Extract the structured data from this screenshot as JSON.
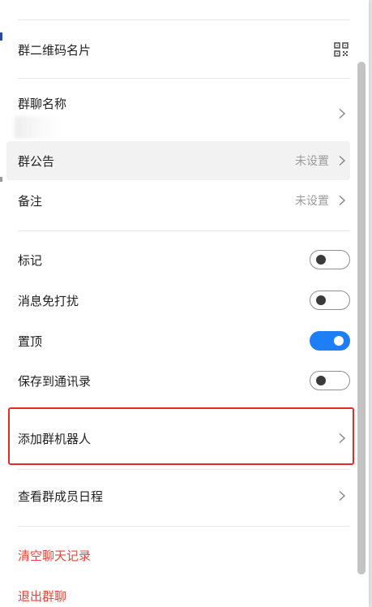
{
  "menu": {
    "qr_card": {
      "label": "群二维码名片",
      "icon": "qr-code-icon"
    },
    "group_name": {
      "label": "群聊名称"
    },
    "announcement": {
      "label": "群公告",
      "value": "未设置"
    },
    "remark": {
      "label": "备注",
      "value": "未设置"
    },
    "mark": {
      "label": "标记",
      "toggle": false
    },
    "mute": {
      "label": "消息免打扰",
      "toggle": false
    },
    "pin": {
      "label": "置顶",
      "toggle": true
    },
    "save_contacts": {
      "label": "保存到通讯录",
      "toggle": false
    },
    "add_bot": {
      "label": "添加群机器人"
    },
    "member_schedule": {
      "label": "查看群成员日程"
    },
    "clear_history": {
      "label": "清空聊天记录"
    },
    "leave_group": {
      "label": "退出群聊"
    }
  },
  "colors": {
    "toggle_on": "#1e7ef5",
    "danger_text": "#e8453c",
    "highlight_border": "#e52a2a"
  }
}
